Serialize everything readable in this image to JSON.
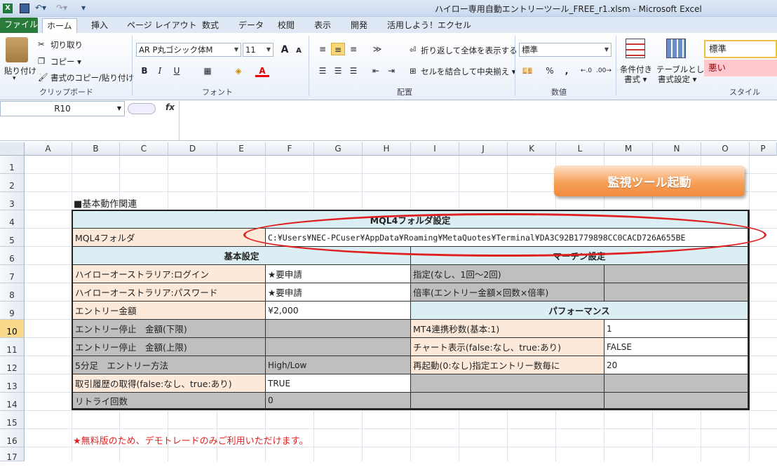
{
  "window": {
    "title": "ハイロー専用自動エントリーツール_FREE_r1.xlsm  -  Microsoft Excel"
  },
  "tabs": [
    "ファイル",
    "ホーム",
    "挿入",
    "ページ レイアウト",
    "数式",
    "データ",
    "校閲",
    "表示",
    "開発",
    "活用しよう！エクセル"
  ],
  "ribbon": {
    "clipboard": {
      "paste": "貼り付け",
      "cut": "切り取り",
      "copy": "コピー ▾",
      "format_painter": "書式のコピー/貼り付け",
      "label": "クリップボード"
    },
    "font": {
      "name": "AR P丸ゴシック体M",
      "size": "11",
      "label": "フォント",
      "grow": "A",
      "shrink": "A",
      "bold": "B",
      "italic": "I",
      "underline": "U"
    },
    "alignment": {
      "wrap": "折り返して全体を表示する",
      "merge": "セルを結合して中央揃え ▾",
      "label": "配置"
    },
    "number": {
      "format": "標準",
      "label": "数値",
      "percent": "%",
      "comma": ","
    },
    "styles": {
      "cond_line1": "条件付き",
      "cond_line2": "書式 ▾",
      "table_line1": "テーブルとして",
      "table_line2": "書式設定 ▾",
      "style_normal": "標準",
      "style_bad": "悪い",
      "label": "スタイル"
    }
  },
  "formula_bar": {
    "name_box": "R10",
    "fx": "fx",
    "value": ""
  },
  "columns": [
    "A",
    "B",
    "C",
    "D",
    "E",
    "F",
    "G",
    "H",
    "I",
    "J",
    "K",
    "L",
    "M",
    "N",
    "O",
    "P"
  ],
  "rows": [
    "1",
    "2",
    "3",
    "4",
    "5",
    "6",
    "7",
    "8",
    "9",
    "10",
    "11",
    "12",
    "13",
    "14",
    "15",
    "16",
    "17"
  ],
  "sheet": {
    "launch_button": "監視ツール起動",
    "section_title": "■基本動作関連",
    "mql4_header": "MQL4フォルダ設定",
    "mql4_label": "MQL4フォルダ",
    "mql4_path": "C:¥Users¥NEC-PCuser¥AppData¥Roaming¥MetaQuotes¥Terminal¥DA3C92B1779898CC0CACD726A655BE",
    "basic_header": "基本設定",
    "martin_header": "マーチン設定",
    "perf_header": "パフォーマンス",
    "basic": [
      {
        "label": "ハイローオーストラリア:ログイン",
        "value": "★要申請"
      },
      {
        "label": "ハイローオーストラリア:パスワード",
        "value": "★要申請"
      },
      {
        "label": "エントリー金額",
        "value": "¥2,000"
      },
      {
        "label": "エントリー停止　金額(下限)",
        "value": ""
      },
      {
        "label": "エントリー停止　金額(上限)",
        "value": ""
      },
      {
        "label": "5分足　エントリー方法",
        "value": "High/Low"
      },
      {
        "label": "取引履歴の取得(false:なし、true:あり)",
        "value": "TRUE"
      },
      {
        "label": "リトライ回数",
        "value": "0"
      }
    ],
    "martin": [
      {
        "label": "指定(なし、1回～2回)",
        "value": ""
      },
      {
        "label": "倍率(エントリー金額×回数×倍率)",
        "value": ""
      }
    ],
    "performance": [
      {
        "label": "MT4連携秒数(基本:1)",
        "value": "1"
      },
      {
        "label": "チャート表示(false:なし、true:あり)",
        "value": "FALSE"
      },
      {
        "label": "再起動(0:なし)指定エントリー数毎に",
        "value": "20"
      }
    ],
    "note": "★無料版のため、デモトレードのみご利用いただけます。"
  },
  "colors": {
    "accent_red": "#e02020",
    "peach": "#fde9d9",
    "grey": "#bfbfbf",
    "header_blue": "#daeef3",
    "button_orange": "#f7a15a"
  }
}
